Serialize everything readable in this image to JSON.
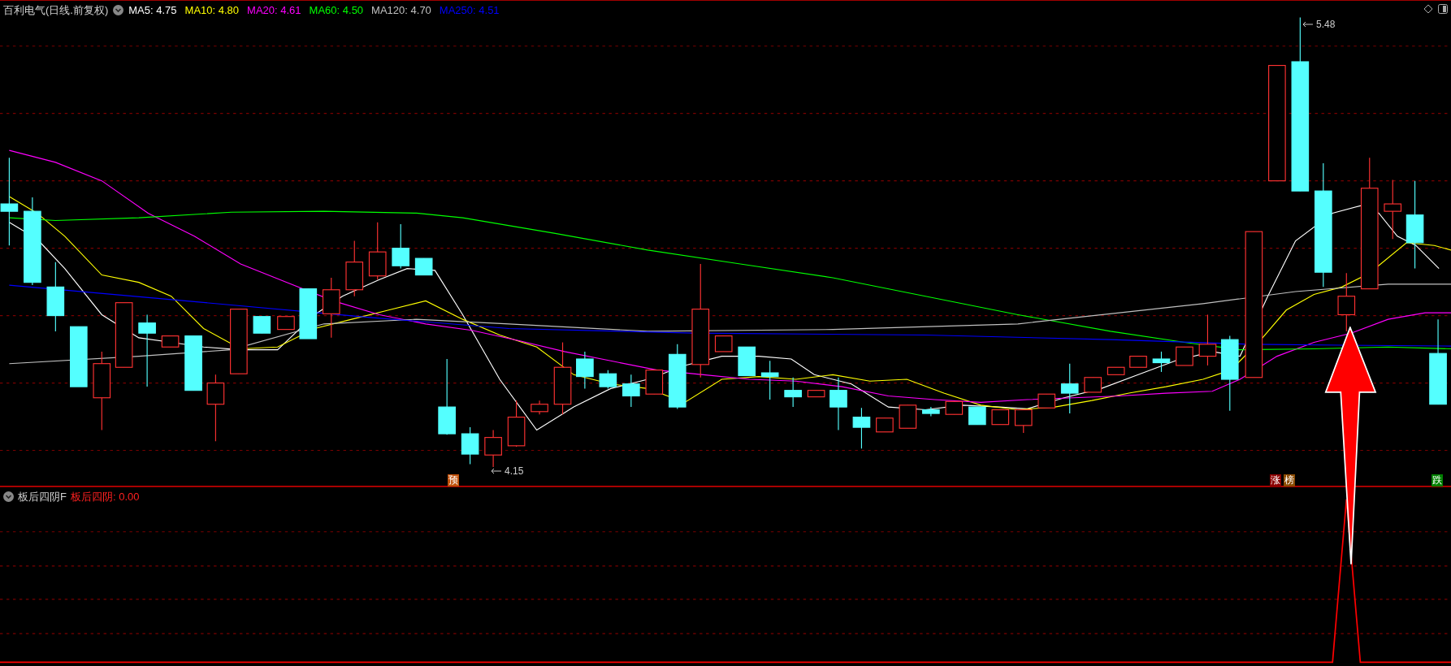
{
  "main_chart": {
    "title": "百利电气(日线.前复权)",
    "moving_averages": [
      {
        "label": "MA5:",
        "value": "4.75",
        "color": "#ffffff"
      },
      {
        "label": "MA10:",
        "value": "4.80",
        "color": "#ffff00"
      },
      {
        "label": "MA20:",
        "value": "4.61",
        "color": "#ff00ff"
      },
      {
        "label": "MA60:",
        "value": "4.50",
        "color": "#00ff00"
      },
      {
        "label": "MA120:",
        "value": "4.70",
        "color": "#c0c0c0"
      },
      {
        "label": "MA250:",
        "value": "4.51",
        "color": "#0000ff"
      }
    ],
    "price_labels": [
      {
        "text": "5.48",
        "kind": "high"
      },
      {
        "text": "4.15",
        "kind": "low"
      }
    ],
    "signals": [
      {
        "text": "预",
        "color": "#c0500a"
      },
      {
        "text": "涨",
        "color": "#8b0000"
      },
      {
        "text": "榜",
        "color": "#8b4a00"
      },
      {
        "text": "跌",
        "color": "#008000"
      }
    ]
  },
  "indicator_panel": {
    "name": "板后四阴F",
    "reading_label": "板后四阴:",
    "reading_value": "0.00"
  }
}
